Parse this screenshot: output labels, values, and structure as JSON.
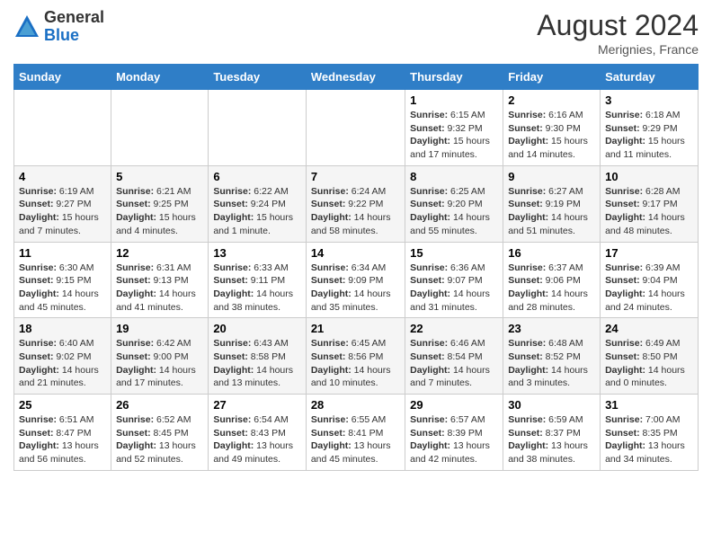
{
  "header": {
    "logo_general": "General",
    "logo_blue": "Blue",
    "month_year": "August 2024",
    "location": "Merignies, France"
  },
  "days_of_week": [
    "Sunday",
    "Monday",
    "Tuesday",
    "Wednesday",
    "Thursday",
    "Friday",
    "Saturday"
  ],
  "weeks": [
    [
      {
        "day": "",
        "info": ""
      },
      {
        "day": "",
        "info": ""
      },
      {
        "day": "",
        "info": ""
      },
      {
        "day": "",
        "info": ""
      },
      {
        "day": "1",
        "info": "Sunrise: 6:15 AM\nSunset: 9:32 PM\nDaylight: 15 hours and 17 minutes."
      },
      {
        "day": "2",
        "info": "Sunrise: 6:16 AM\nSunset: 9:30 PM\nDaylight: 15 hours and 14 minutes."
      },
      {
        "day": "3",
        "info": "Sunrise: 6:18 AM\nSunset: 9:29 PM\nDaylight: 15 hours and 11 minutes."
      }
    ],
    [
      {
        "day": "4",
        "info": "Sunrise: 6:19 AM\nSunset: 9:27 PM\nDaylight: 15 hours and 7 minutes."
      },
      {
        "day": "5",
        "info": "Sunrise: 6:21 AM\nSunset: 9:25 PM\nDaylight: 15 hours and 4 minutes."
      },
      {
        "day": "6",
        "info": "Sunrise: 6:22 AM\nSunset: 9:24 PM\nDaylight: 15 hours and 1 minute."
      },
      {
        "day": "7",
        "info": "Sunrise: 6:24 AM\nSunset: 9:22 PM\nDaylight: 14 hours and 58 minutes."
      },
      {
        "day": "8",
        "info": "Sunrise: 6:25 AM\nSunset: 9:20 PM\nDaylight: 14 hours and 55 minutes."
      },
      {
        "day": "9",
        "info": "Sunrise: 6:27 AM\nSunset: 9:19 PM\nDaylight: 14 hours and 51 minutes."
      },
      {
        "day": "10",
        "info": "Sunrise: 6:28 AM\nSunset: 9:17 PM\nDaylight: 14 hours and 48 minutes."
      }
    ],
    [
      {
        "day": "11",
        "info": "Sunrise: 6:30 AM\nSunset: 9:15 PM\nDaylight: 14 hours and 45 minutes."
      },
      {
        "day": "12",
        "info": "Sunrise: 6:31 AM\nSunset: 9:13 PM\nDaylight: 14 hours and 41 minutes."
      },
      {
        "day": "13",
        "info": "Sunrise: 6:33 AM\nSunset: 9:11 PM\nDaylight: 14 hours and 38 minutes."
      },
      {
        "day": "14",
        "info": "Sunrise: 6:34 AM\nSunset: 9:09 PM\nDaylight: 14 hours and 35 minutes."
      },
      {
        "day": "15",
        "info": "Sunrise: 6:36 AM\nSunset: 9:07 PM\nDaylight: 14 hours and 31 minutes."
      },
      {
        "day": "16",
        "info": "Sunrise: 6:37 AM\nSunset: 9:06 PM\nDaylight: 14 hours and 28 minutes."
      },
      {
        "day": "17",
        "info": "Sunrise: 6:39 AM\nSunset: 9:04 PM\nDaylight: 14 hours and 24 minutes."
      }
    ],
    [
      {
        "day": "18",
        "info": "Sunrise: 6:40 AM\nSunset: 9:02 PM\nDaylight: 14 hours and 21 minutes."
      },
      {
        "day": "19",
        "info": "Sunrise: 6:42 AM\nSunset: 9:00 PM\nDaylight: 14 hours and 17 minutes."
      },
      {
        "day": "20",
        "info": "Sunrise: 6:43 AM\nSunset: 8:58 PM\nDaylight: 14 hours and 13 minutes."
      },
      {
        "day": "21",
        "info": "Sunrise: 6:45 AM\nSunset: 8:56 PM\nDaylight: 14 hours and 10 minutes."
      },
      {
        "day": "22",
        "info": "Sunrise: 6:46 AM\nSunset: 8:54 PM\nDaylight: 14 hours and 7 minutes."
      },
      {
        "day": "23",
        "info": "Sunrise: 6:48 AM\nSunset: 8:52 PM\nDaylight: 14 hours and 3 minutes."
      },
      {
        "day": "24",
        "info": "Sunrise: 6:49 AM\nSunset: 8:50 PM\nDaylight: 14 hours and 0 minutes."
      }
    ],
    [
      {
        "day": "25",
        "info": "Sunrise: 6:51 AM\nSunset: 8:47 PM\nDaylight: 13 hours and 56 minutes."
      },
      {
        "day": "26",
        "info": "Sunrise: 6:52 AM\nSunset: 8:45 PM\nDaylight: 13 hours and 52 minutes."
      },
      {
        "day": "27",
        "info": "Sunrise: 6:54 AM\nSunset: 8:43 PM\nDaylight: 13 hours and 49 minutes."
      },
      {
        "day": "28",
        "info": "Sunrise: 6:55 AM\nSunset: 8:41 PM\nDaylight: 13 hours and 45 minutes."
      },
      {
        "day": "29",
        "info": "Sunrise: 6:57 AM\nSunset: 8:39 PM\nDaylight: 13 hours and 42 minutes."
      },
      {
        "day": "30",
        "info": "Sunrise: 6:59 AM\nSunset: 8:37 PM\nDaylight: 13 hours and 38 minutes."
      },
      {
        "day": "31",
        "info": "Sunrise: 7:00 AM\nSunset: 8:35 PM\nDaylight: 13 hours and 34 minutes."
      }
    ]
  ]
}
